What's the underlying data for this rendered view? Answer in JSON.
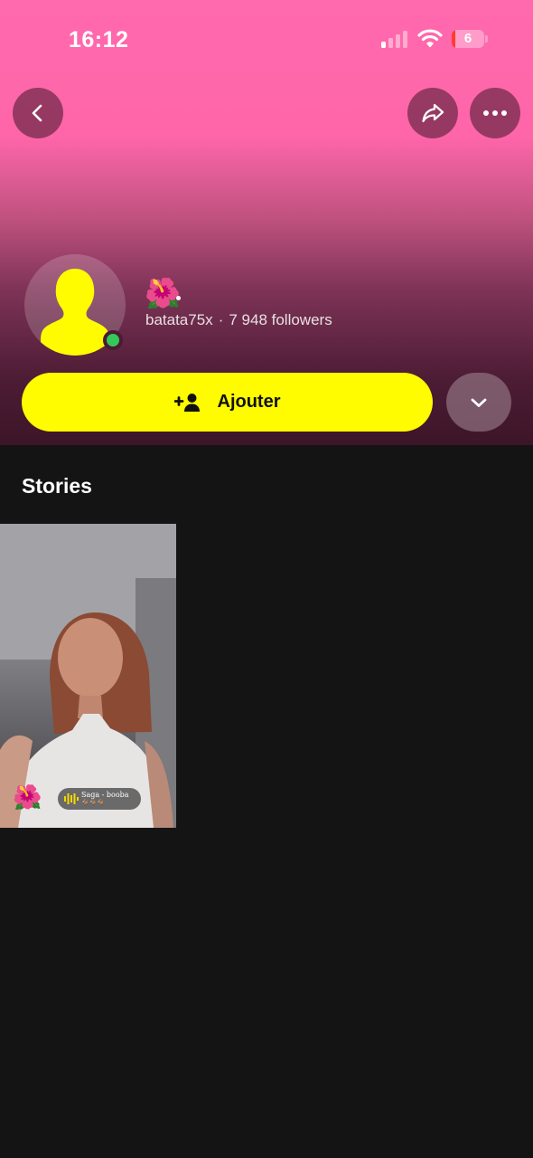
{
  "status_bar": {
    "time": "16:12",
    "battery_level": "6",
    "signal_bars_active": 1,
    "signal_bars_total": 4
  },
  "nav": {
    "back_icon": "chevron-left-icon",
    "share_icon": "share-arrow-icon",
    "more_icon": "ellipsis-icon"
  },
  "profile": {
    "display_name": "🌺",
    "username": "batata75x",
    "separator": "·",
    "followers": "7 948 followers",
    "online": true
  },
  "actions": {
    "add_label": "Ajouter",
    "add_icon": "add-friend-icon",
    "dropdown_icon": "chevron-down-icon"
  },
  "stories": {
    "heading": "Stories",
    "items": [
      {
        "emoji": "🌺",
        "music_title": "Saga - booba",
        "music_sub": "🐐🐐🐐"
      }
    ]
  },
  "colors": {
    "header_top": "#ff69ad",
    "header_bottom": "#3c1528",
    "add_button": "#fffc00",
    "background": "#141414",
    "online": "#34c759"
  }
}
